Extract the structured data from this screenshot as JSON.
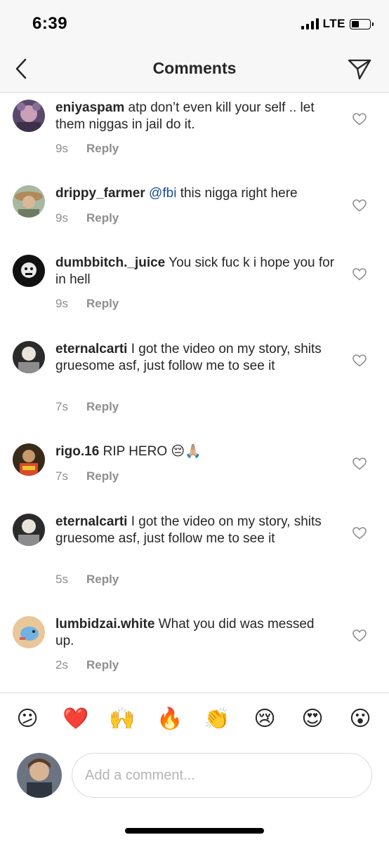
{
  "status_bar": {
    "time": "6:39",
    "network": "LTE"
  },
  "nav": {
    "title": "Comments"
  },
  "comments": [
    {
      "user": "eniyaspam",
      "mention": "",
      "text": " atp don’t even kill your self .. let them niggas in jail do it.",
      "time": "9s",
      "reply": "Reply"
    },
    {
      "user": "drippy_farmer",
      "mention": " @fbi",
      "text": " this nigga right here",
      "time": "9s",
      "reply": "Reply"
    },
    {
      "user": "dumbbitch._juice",
      "mention": "",
      "text": " You sick fuc k i hope you for in hell",
      "time": "9s",
      "reply": "Reply"
    },
    {
      "user": "eternalcarti",
      "mention": "",
      "text": " I got the video on my story, shits gruesome asf, just follow me to see it",
      "time": "7s",
      "reply": "Reply"
    },
    {
      "user": "rigo.16",
      "mention": "",
      "text": " RIP HERO 😔🙏🏼",
      "time": "7s",
      "reply": "Reply"
    },
    {
      "user": "eternalcarti",
      "mention": "",
      "text": " I got the video on my story, shits gruesome asf, just follow me to see it",
      "time": "5s",
      "reply": "Reply"
    },
    {
      "user": "lumbidzai.white",
      "mention": "",
      "text": " What you did was messed up.",
      "time": "2s",
      "reply": "Reply"
    }
  ],
  "emoji_bar": [
    "😕",
    "❤️",
    "🙌",
    "🔥",
    "👏",
    "😢",
    "😍",
    "😮"
  ],
  "composer": {
    "placeholder": "Add a comment..."
  }
}
